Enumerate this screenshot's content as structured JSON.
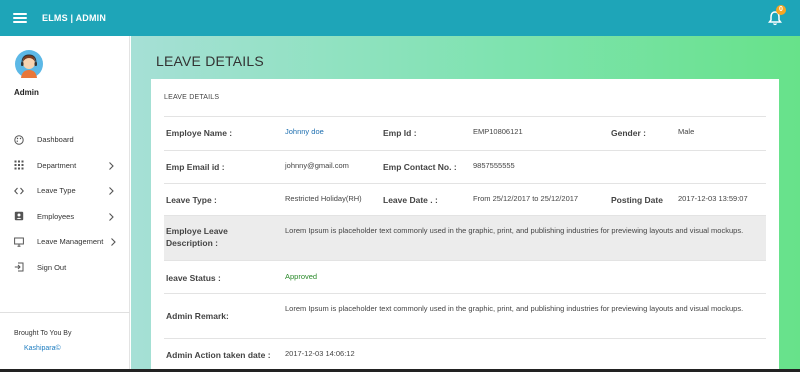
{
  "header": {
    "brand": "ELMS | ADMIN",
    "notification_count": "0"
  },
  "sidebar": {
    "user_name": "Admin",
    "menu": [
      {
        "label": "Dashboard",
        "icon": "palette-icon",
        "has_submenu": false
      },
      {
        "label": "Department",
        "icon": "grid-icon",
        "has_submenu": true
      },
      {
        "label": "Leave Type",
        "icon": "code-icon",
        "has_submenu": true
      },
      {
        "label": "Employees",
        "icon": "id-card-icon",
        "has_submenu": true
      },
      {
        "label": "Leave Management",
        "icon": "desktop-icon",
        "has_submenu": true
      },
      {
        "label": "Sign Out",
        "icon": "sign-out-icon",
        "has_submenu": false
      }
    ],
    "footer_text": "Brought To You By",
    "footer_link": "Kashipara©"
  },
  "page": {
    "title": "LEAVE DETAILS",
    "card_title": "LEAVE DETAILS",
    "details": {
      "employee_name_label": "Employe Name :",
      "employee_name": "Johnny doe",
      "emp_id_label": "Emp Id :",
      "emp_id": "EMP10806121",
      "gender_label": "Gender :",
      "gender": "Male",
      "email_label": "Emp Email id :",
      "email": "johnny@gmail.com",
      "contact_label": "Emp Contact No. :",
      "contact": "9857555555",
      "leave_type_label": "Leave Type :",
      "leave_type": "Restricted Holiday(RH)",
      "leave_date_label": "Leave Date . :",
      "leave_date": "From 25/12/2017 to 25/12/2017",
      "posting_date_label": "Posting Date",
      "posting_date": "2017-12-03 13:59:07",
      "description_label": "Employe Leave Description :",
      "description": "Lorem Ipsum is placeholder text commonly used in the graphic, print, and publishing industries for previewing layouts and visual mockups.",
      "status_label": "leave Status :",
      "status": "Approved",
      "admin_remark_label": "Admin Remark:",
      "admin_remark": "Lorem Ipsum is placeholder text commonly used in the graphic, print, and publishing industries for previewing layouts and visual mockups.",
      "action_date_label": "Admin Action taken date :",
      "action_date": "2017-12-03 14:06:12"
    }
  },
  "colors": {
    "topbar": "#1ea5b8",
    "status_approved": "#2a8a2a",
    "link": "#1e6fb0",
    "badge": "#f6a623"
  }
}
